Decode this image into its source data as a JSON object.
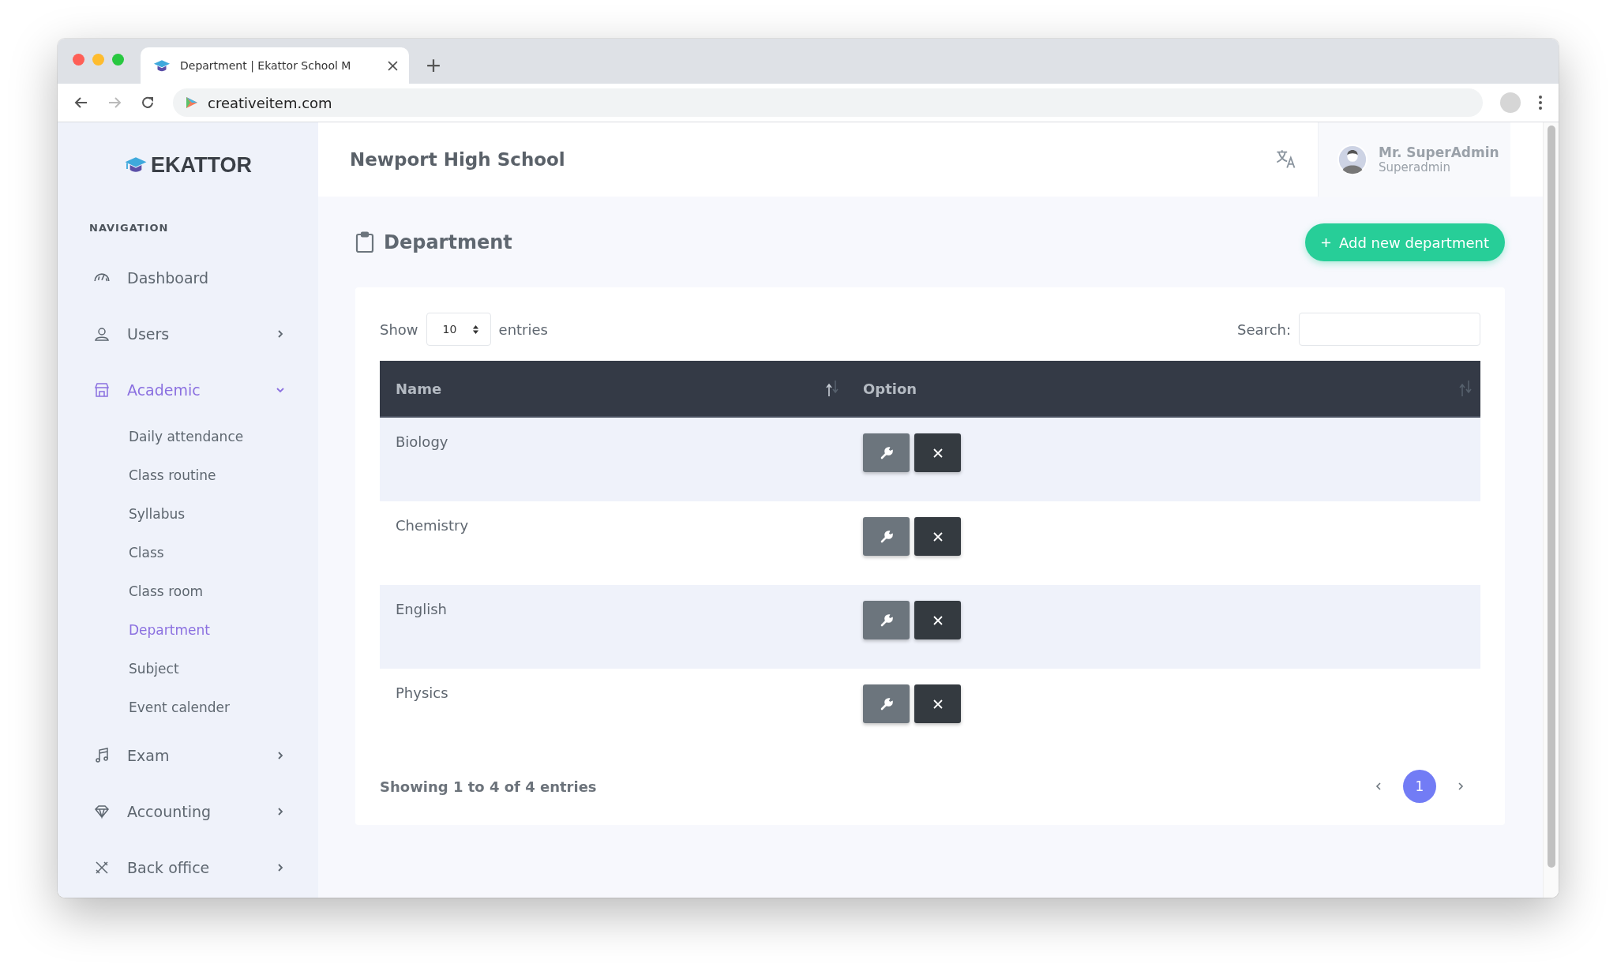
{
  "browser": {
    "tab_title": "Department | Ekattor School M",
    "address": "creativeitem.com"
  },
  "sidebar": {
    "logo": "EKATTOR",
    "section_label": "NAVIGATION",
    "items": [
      {
        "label": "Dashboard",
        "kind": "link",
        "selected": false
      },
      {
        "label": "Users",
        "kind": "group",
        "selected": false,
        "expanded": false
      },
      {
        "label": "Academic",
        "kind": "group",
        "selected": true,
        "expanded": true,
        "children": [
          {
            "label": "Daily attendance",
            "selected": false
          },
          {
            "label": "Class routine",
            "selected": false
          },
          {
            "label": "Syllabus",
            "selected": false
          },
          {
            "label": "Class",
            "selected": false
          },
          {
            "label": "Class room",
            "selected": false
          },
          {
            "label": "Department",
            "selected": true
          },
          {
            "label": "Subject",
            "selected": false
          },
          {
            "label": "Event calender",
            "selected": false
          }
        ]
      },
      {
        "label": "Exam",
        "kind": "group",
        "selected": false,
        "expanded": false
      },
      {
        "label": "Accounting",
        "kind": "group",
        "selected": false,
        "expanded": false
      },
      {
        "label": "Back office",
        "kind": "group",
        "selected": false,
        "expanded": false
      }
    ]
  },
  "header": {
    "school_name": "Newport High School",
    "user": {
      "name": "Mr. SuperAdmin",
      "role": "Superadmin"
    }
  },
  "page": {
    "title": "Department",
    "add_button": "Add new department"
  },
  "table": {
    "show_label": "Show",
    "length_value": "10",
    "entries_label": "entries",
    "search_label": "Search:",
    "columns": [
      {
        "label": "Name",
        "sorted": true
      },
      {
        "label": "Option",
        "sorted": false
      }
    ],
    "rows": [
      {
        "name": "Biology"
      },
      {
        "name": "Chemistry"
      },
      {
        "name": "English"
      },
      {
        "name": "Physics"
      }
    ],
    "info": "Showing 1 to 4 of 4 entries",
    "pages": [
      {
        "label": "1",
        "selected": true
      }
    ]
  }
}
